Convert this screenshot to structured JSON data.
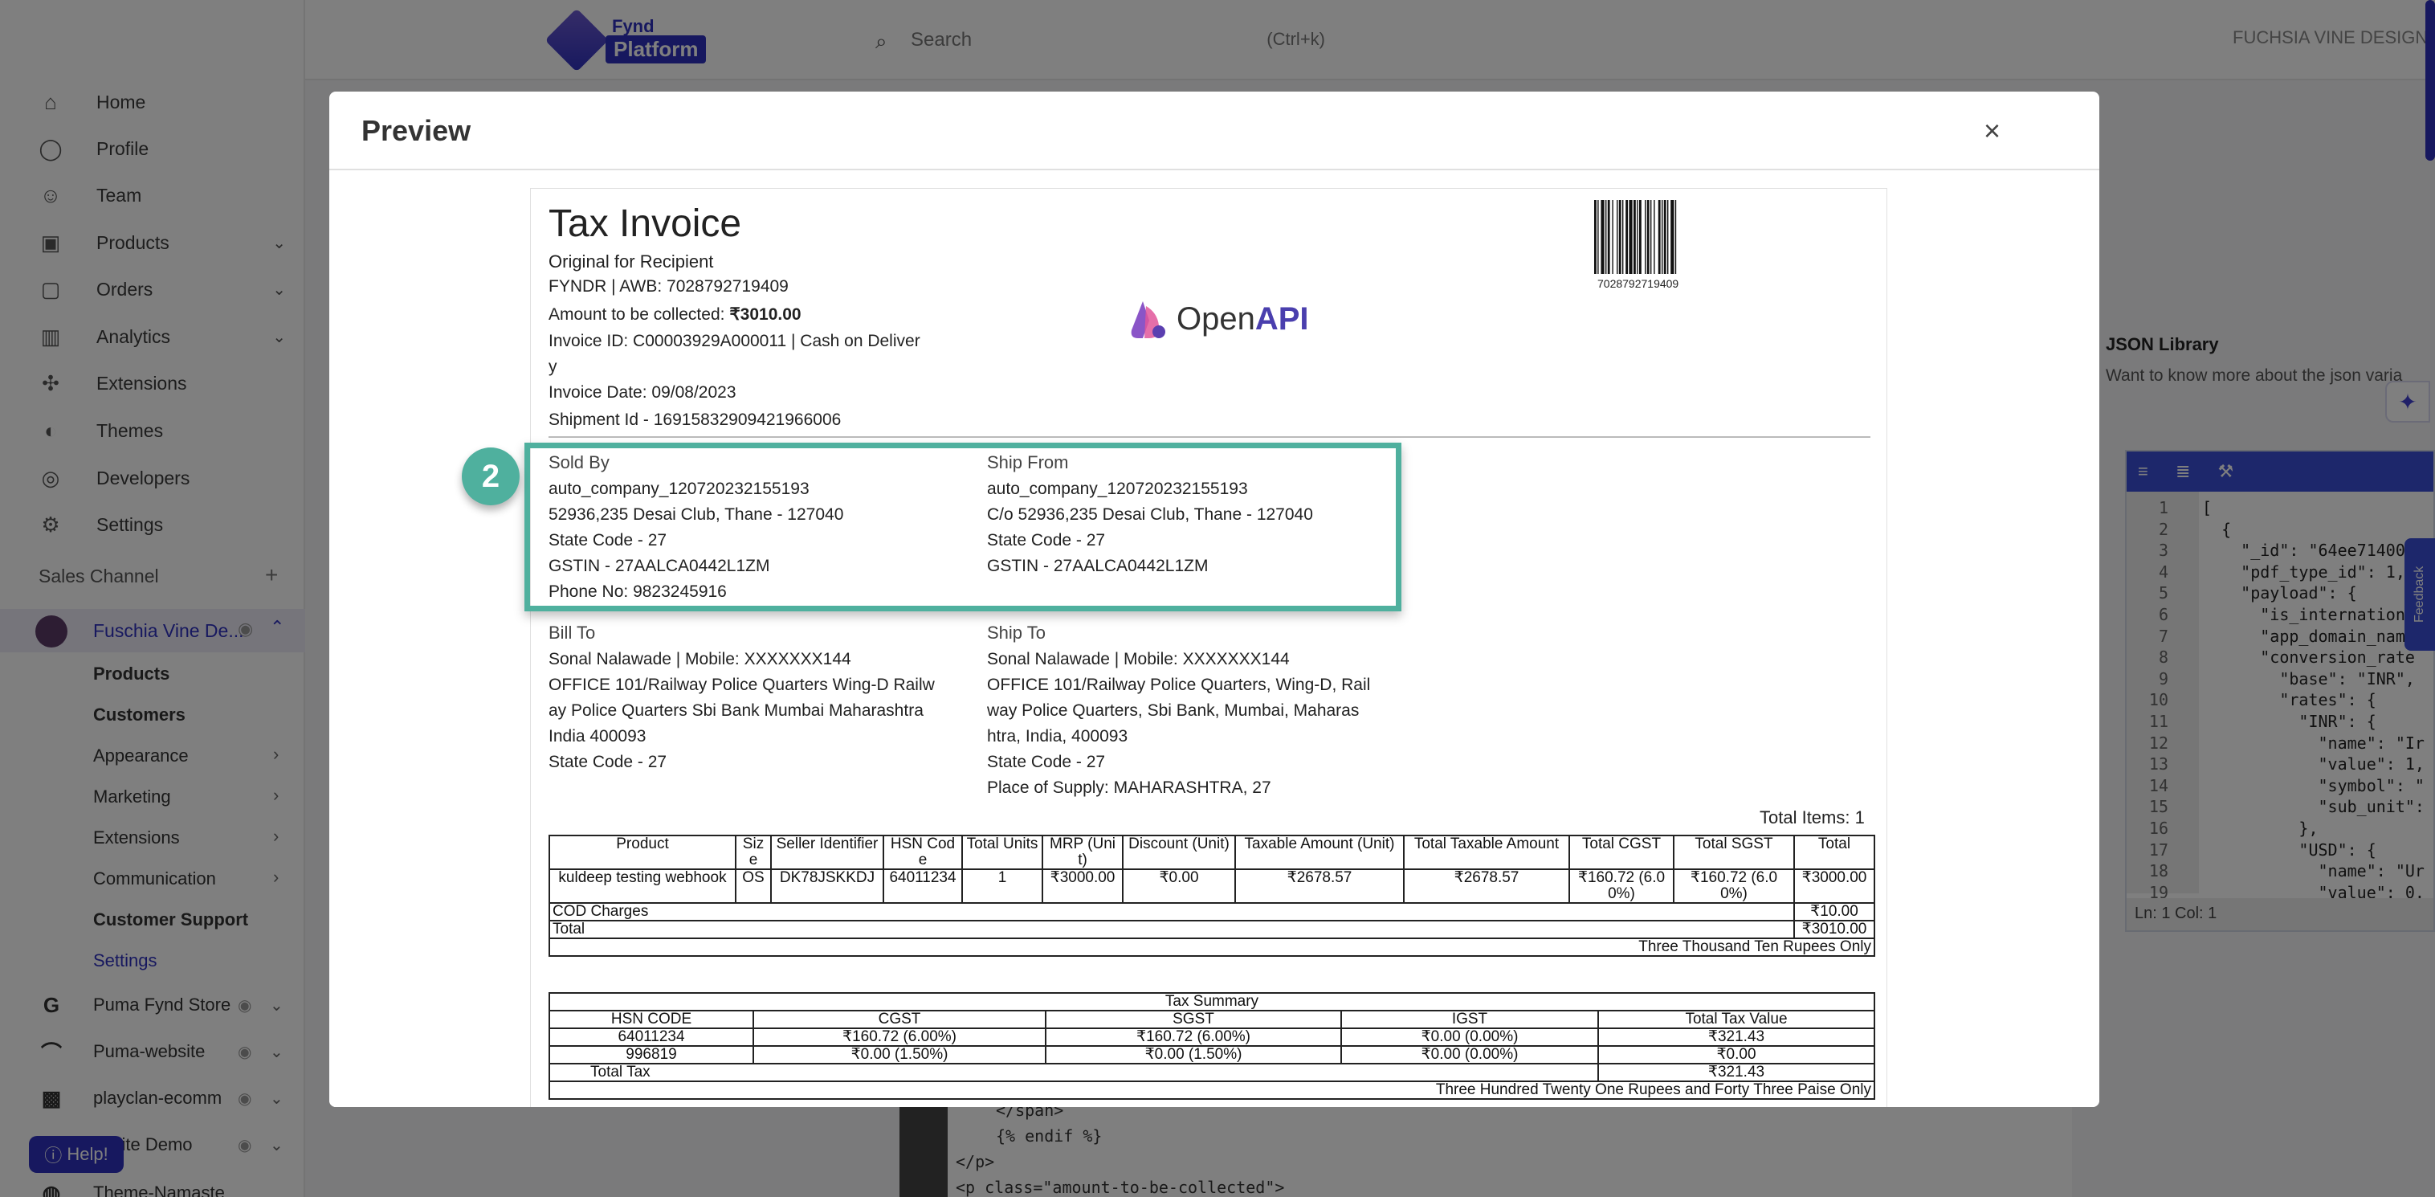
{
  "topbar": {
    "logo_top": "Fynd",
    "logo_bottom": "Platform",
    "search_placeholder": "Search",
    "search_shortcut": "(Ctrl+k)",
    "company": "FUCHSIA VINE DESIGN"
  },
  "sidebar": {
    "items": [
      {
        "label": "Home",
        "icon": "home-icon"
      },
      {
        "label": "Profile",
        "icon": "profile-icon"
      },
      {
        "label": "Team",
        "icon": "team-icon"
      },
      {
        "label": "Products",
        "icon": "products-icon"
      },
      {
        "label": "Orders",
        "icon": "orders-icon"
      },
      {
        "label": "Analytics",
        "icon": "analytics-icon"
      },
      {
        "label": "Extensions",
        "icon": "extensions-icon"
      },
      {
        "label": "Themes",
        "icon": "themes-icon"
      },
      {
        "label": "Developers",
        "icon": "developers-icon"
      },
      {
        "label": "Settings",
        "icon": "settings-icon"
      }
    ],
    "section_label": "Sales Channel",
    "active_channel": "Fuschia Vine De...",
    "sub_items": [
      "Products",
      "Customers",
      "Appearance",
      "Marketing",
      "Extensions",
      "Communication",
      "Customer Support",
      "Settings"
    ],
    "channels": [
      "Puma Fynd Store",
      "Puma-website",
      "playclan-ecomm",
      "ebsite Demo",
      "Theme-Namaste"
    ],
    "help": "Help!"
  },
  "background": {
    "json_library_title": "JSON Library",
    "json_library_sub": "Want to know more about the json varia",
    "editor_status": "Ln: 1    Col: 1",
    "feedback": "Feedback",
    "code_lines": [
      "</span>",
      "{% endif %}",
      "</p>",
      "<p class=\"amount-to-be-collected\">"
    ],
    "editor_lines": [
      "[",
      "  {",
      "    \"_id\": \"64ee71400",
      "    \"pdf_type_id\": 1,",
      "    \"payload\": {",
      "      \"is_internation",
      "      \"app_domain_nam",
      "      \"conversion_rate",
      "        \"base\": \"INR\",",
      "        \"rates\": {",
      "          \"INR\": {",
      "            \"name\": \"Ir",
      "            \"value\": 1,",
      "            \"symbol\": \"",
      "            \"sub_unit\":",
      "          },",
      "          \"USD\": {",
      "            \"name\": \"Ur",
      "            \"value\": 0."
    ]
  },
  "modal": {
    "title": "Preview",
    "close": "×"
  },
  "invoice": {
    "title": "Tax Invoice",
    "subtitle": "Original for Recipient",
    "awb": "FYNDR | AWB: 7028792719409",
    "amount_label": "Amount to be collected: ",
    "amount_value": "₹3010.00",
    "invoice_id": "Invoice ID: C00003929A000011 | Cash on Deliver",
    "invoice_id_wrap": "y",
    "invoice_date": "Invoice Date: 09/08/2023",
    "shipment_id": "Shipment Id - 16915832909421966006",
    "barcode_number": "7028792719409",
    "brand_open": "Open",
    "brand_api": "API",
    "badge": "2",
    "sold_by": {
      "heading": "Sold By",
      "lines": [
        "auto_company_120720232155193",
        "52936,235 Desai Club, Thane - 127040",
        "State Code - 27",
        "GSTIN - 27AALCA0442L1ZM",
        "Phone No: 9823245916"
      ]
    },
    "ship_from": {
      "heading": "Ship From",
      "lines": [
        "auto_company_120720232155193",
        "C/o 52936,235 Desai Club, Thane - 127040",
        "State Code - 27",
        "GSTIN - 27AALCA0442L1ZM"
      ]
    },
    "bill_to": {
      "heading": "Bill To",
      "lines": [
        "Sonal Nalawade | Mobile: XXXXXXX144",
        "OFFICE 101/Railway Police Quarters Wing-D Railw",
        "ay Police Quarters Sbi Bank Mumbai Maharashtra",
        "India 400093",
        "State Code - 27"
      ]
    },
    "ship_to": {
      "heading": "Ship To",
      "lines": [
        "Sonal Nalawade | Mobile: XXXXXXX144",
        "OFFICE 101/Railway Police Quarters, Wing-D, Rail",
        "way Police Quarters, Sbi Bank, Mumbai, Maharas",
        "htra, India, 400093",
        "State Code - 27",
        "Place of Supply: MAHARASHTRA, 27"
      ]
    },
    "total_items": "Total Items: 1",
    "items_table": {
      "headers": [
        "Product",
        "Size",
        "Seller Identifier",
        "HSN Code",
        "Total Units",
        "MRP (Unit)",
        "Discount (Unit)",
        "Taxable Amount (Unit)",
        "Total Taxable Amount",
        "Total CGST",
        "Total SGST",
        "Total"
      ],
      "row": [
        "kuldeep testing webhook",
        "OS",
        "DK78JSKKDJ",
        "64011234",
        "1",
        "₹3000.00",
        "₹0.00",
        "₹2678.57",
        "₹2678.57",
        "₹160.72 (6.0 0%)",
        "₹160.72 (6.0 0%)",
        "₹3000.00"
      ],
      "cod_label": "COD Charges",
      "cod_value": "₹10.00",
      "total_label": "Total",
      "total_value": "₹3010.00",
      "in_words": "Three Thousand Ten Rupees Only"
    },
    "tax_summary": {
      "title": "Tax Summary",
      "headers": [
        "HSN CODE",
        "CGST",
        "SGST",
        "IGST",
        "Total Tax Value"
      ],
      "rows": [
        [
          "64011234",
          "₹160.72 (6.00%)",
          "₹160.72 (6.00%)",
          "₹0.00 (0.00%)",
          "₹321.43"
        ],
        [
          "996819",
          "₹0.00 (1.50%)",
          "₹0.00 (1.50%)",
          "₹0.00 (0.00%)",
          "₹0.00"
        ]
      ],
      "total_label": "Total Tax",
      "total_value": "₹321.43",
      "in_words": "Three Hundred Twenty One Rupees and Forty Three Paise Only"
    }
  }
}
